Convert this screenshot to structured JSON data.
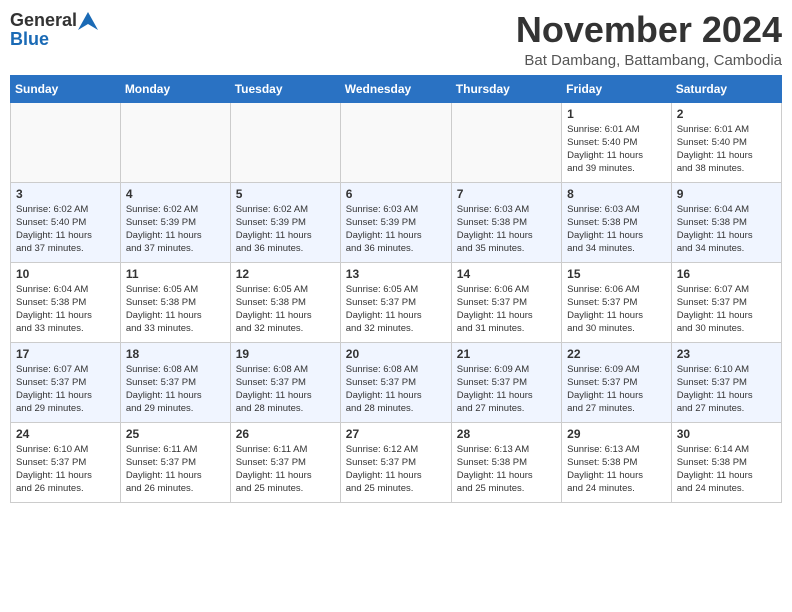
{
  "header": {
    "logo_general": "General",
    "logo_blue": "Blue",
    "month_title": "November 2024",
    "location": "Bat Dambang, Battambang, Cambodia"
  },
  "weekdays": [
    "Sunday",
    "Monday",
    "Tuesday",
    "Wednesday",
    "Thursday",
    "Friday",
    "Saturday"
  ],
  "weeks": [
    [
      {
        "day": "",
        "info": ""
      },
      {
        "day": "",
        "info": ""
      },
      {
        "day": "",
        "info": ""
      },
      {
        "day": "",
        "info": ""
      },
      {
        "day": "",
        "info": ""
      },
      {
        "day": "1",
        "info": "Sunrise: 6:01 AM\nSunset: 5:40 PM\nDaylight: 11 hours\nand 39 minutes."
      },
      {
        "day": "2",
        "info": "Sunrise: 6:01 AM\nSunset: 5:40 PM\nDaylight: 11 hours\nand 38 minutes."
      }
    ],
    [
      {
        "day": "3",
        "info": "Sunrise: 6:02 AM\nSunset: 5:40 PM\nDaylight: 11 hours\nand 37 minutes."
      },
      {
        "day": "4",
        "info": "Sunrise: 6:02 AM\nSunset: 5:39 PM\nDaylight: 11 hours\nand 37 minutes."
      },
      {
        "day": "5",
        "info": "Sunrise: 6:02 AM\nSunset: 5:39 PM\nDaylight: 11 hours\nand 36 minutes."
      },
      {
        "day": "6",
        "info": "Sunrise: 6:03 AM\nSunset: 5:39 PM\nDaylight: 11 hours\nand 36 minutes."
      },
      {
        "day": "7",
        "info": "Sunrise: 6:03 AM\nSunset: 5:38 PM\nDaylight: 11 hours\nand 35 minutes."
      },
      {
        "day": "8",
        "info": "Sunrise: 6:03 AM\nSunset: 5:38 PM\nDaylight: 11 hours\nand 34 minutes."
      },
      {
        "day": "9",
        "info": "Sunrise: 6:04 AM\nSunset: 5:38 PM\nDaylight: 11 hours\nand 34 minutes."
      }
    ],
    [
      {
        "day": "10",
        "info": "Sunrise: 6:04 AM\nSunset: 5:38 PM\nDaylight: 11 hours\nand 33 minutes."
      },
      {
        "day": "11",
        "info": "Sunrise: 6:05 AM\nSunset: 5:38 PM\nDaylight: 11 hours\nand 33 minutes."
      },
      {
        "day": "12",
        "info": "Sunrise: 6:05 AM\nSunset: 5:38 PM\nDaylight: 11 hours\nand 32 minutes."
      },
      {
        "day": "13",
        "info": "Sunrise: 6:05 AM\nSunset: 5:37 PM\nDaylight: 11 hours\nand 32 minutes."
      },
      {
        "day": "14",
        "info": "Sunrise: 6:06 AM\nSunset: 5:37 PM\nDaylight: 11 hours\nand 31 minutes."
      },
      {
        "day": "15",
        "info": "Sunrise: 6:06 AM\nSunset: 5:37 PM\nDaylight: 11 hours\nand 30 minutes."
      },
      {
        "day": "16",
        "info": "Sunrise: 6:07 AM\nSunset: 5:37 PM\nDaylight: 11 hours\nand 30 minutes."
      }
    ],
    [
      {
        "day": "17",
        "info": "Sunrise: 6:07 AM\nSunset: 5:37 PM\nDaylight: 11 hours\nand 29 minutes."
      },
      {
        "day": "18",
        "info": "Sunrise: 6:08 AM\nSunset: 5:37 PM\nDaylight: 11 hours\nand 29 minutes."
      },
      {
        "day": "19",
        "info": "Sunrise: 6:08 AM\nSunset: 5:37 PM\nDaylight: 11 hours\nand 28 minutes."
      },
      {
        "day": "20",
        "info": "Sunrise: 6:08 AM\nSunset: 5:37 PM\nDaylight: 11 hours\nand 28 minutes."
      },
      {
        "day": "21",
        "info": "Sunrise: 6:09 AM\nSunset: 5:37 PM\nDaylight: 11 hours\nand 27 minutes."
      },
      {
        "day": "22",
        "info": "Sunrise: 6:09 AM\nSunset: 5:37 PM\nDaylight: 11 hours\nand 27 minutes."
      },
      {
        "day": "23",
        "info": "Sunrise: 6:10 AM\nSunset: 5:37 PM\nDaylight: 11 hours\nand 27 minutes."
      }
    ],
    [
      {
        "day": "24",
        "info": "Sunrise: 6:10 AM\nSunset: 5:37 PM\nDaylight: 11 hours\nand 26 minutes."
      },
      {
        "day": "25",
        "info": "Sunrise: 6:11 AM\nSunset: 5:37 PM\nDaylight: 11 hours\nand 26 minutes."
      },
      {
        "day": "26",
        "info": "Sunrise: 6:11 AM\nSunset: 5:37 PM\nDaylight: 11 hours\nand 25 minutes."
      },
      {
        "day": "27",
        "info": "Sunrise: 6:12 AM\nSunset: 5:37 PM\nDaylight: 11 hours\nand 25 minutes."
      },
      {
        "day": "28",
        "info": "Sunrise: 6:13 AM\nSunset: 5:38 PM\nDaylight: 11 hours\nand 25 minutes."
      },
      {
        "day": "29",
        "info": "Sunrise: 6:13 AM\nSunset: 5:38 PM\nDaylight: 11 hours\nand 24 minutes."
      },
      {
        "day": "30",
        "info": "Sunrise: 6:14 AM\nSunset: 5:38 PM\nDaylight: 11 hours\nand 24 minutes."
      }
    ]
  ]
}
